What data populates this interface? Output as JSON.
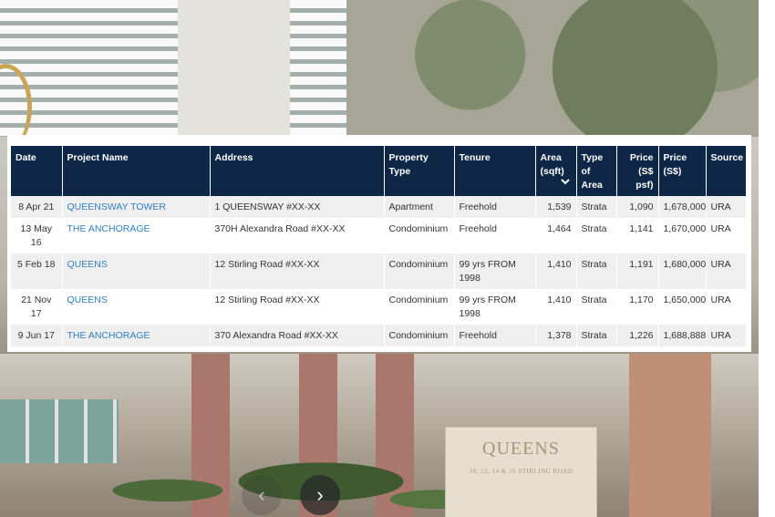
{
  "backdrop": {
    "sign_name": "QUEENS",
    "sign_address": "10, 12, 14 & 16 STIRLING ROAD"
  },
  "carousel": {
    "prev_icon": "chevron-left-icon",
    "next_icon": "chevron-right-icon",
    "prev_glyph": "‹",
    "next_glyph": "›"
  },
  "table": {
    "headers": {
      "date": "Date",
      "project": "Project Name",
      "address": "Address",
      "property_type": "Property Type",
      "tenure": "Tenure",
      "area": "Area (sqft)",
      "type_of_area": "Type of Area",
      "price_psf": "Price (S$ psf)",
      "price": "Price (S$)",
      "source": "Source"
    },
    "sort_icon": "chevron-down-icon",
    "rows": [
      {
        "date": "8 Apr 21",
        "project": "QUEENSWAY TOWER",
        "address": "1 QUEENSWAY #XX-XX",
        "property_type": "Apartment",
        "tenure": "Freehold",
        "area": "1,539",
        "type_of_area": "Strata",
        "price_psf": "1,090",
        "price": "1,678,000",
        "source": "URA"
      },
      {
        "date": "13 May 16",
        "project": "THE ANCHORAGE",
        "address": "370H Alexandra Road #XX-XX",
        "property_type": "Condominium",
        "tenure": "Freehold",
        "area": "1,464",
        "type_of_area": "Strata",
        "price_psf": "1,141",
        "price": "1,670,000",
        "source": "URA"
      },
      {
        "date": "5 Feb 18",
        "project": "QUEENS",
        "address": "12 Stirling Road #XX-XX",
        "property_type": "Condominium",
        "tenure": "99 yrs FROM 1998",
        "area": "1,410",
        "type_of_area": "Strata",
        "price_psf": "1,191",
        "price": "1,680,000",
        "source": "URA"
      },
      {
        "date": "21 Nov 17",
        "project": "QUEENS",
        "address": "12 Stirling Road #XX-XX",
        "property_type": "Condominium",
        "tenure": "99 yrs FROM 1998",
        "area": "1,410",
        "type_of_area": "Strata",
        "price_psf": "1,170",
        "price": "1,650,000",
        "source": "URA"
      },
      {
        "date": "9 Jun 17",
        "project": "THE ANCHORAGE",
        "address": "370 Alexandra Road #XX-XX",
        "property_type": "Condominium",
        "tenure": "Freehold",
        "area": "1,378",
        "type_of_area": "Strata",
        "price_psf": "1,226",
        "price": "1,688,888",
        "source": "URA"
      }
    ]
  }
}
